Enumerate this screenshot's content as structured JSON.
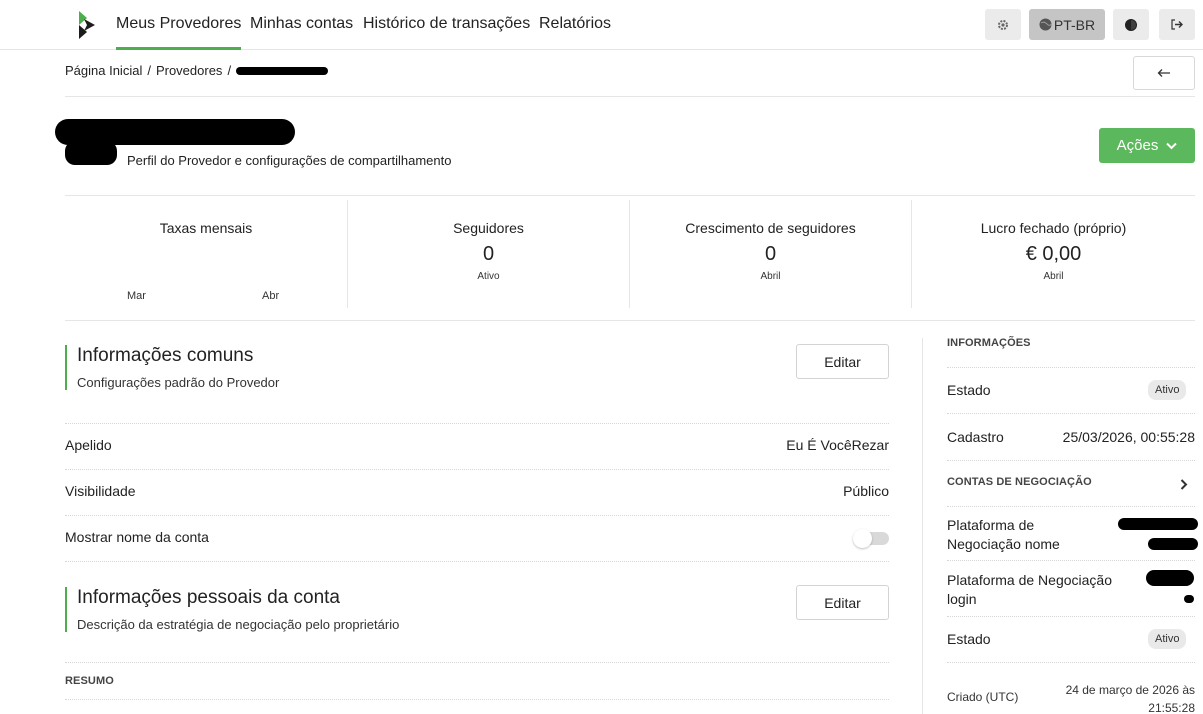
{
  "nav": {
    "items": [
      {
        "label": "Meus Provedores",
        "active": true
      },
      {
        "label": "Minhas contas",
        "active": false
      },
      {
        "label": "Histórico de transações",
        "active": false
      },
      {
        "label": "Relatórios",
        "active": false
      }
    ],
    "language_label": "PT-BR",
    "settings_icon": "gear-icon",
    "theme_icon": "contrast-icon",
    "logout_icon": "logout-icon"
  },
  "breadcrumb": {
    "home": "Página Inicial",
    "separator": "/",
    "providers": "Provedores"
  },
  "back_icon": "arrow-left-icon",
  "profile": {
    "subtitle": "Perfil do Provedor e configurações de compartilhamento",
    "actions_label": "Ações"
  },
  "stats": {
    "monthly_fees": {
      "label": "Taxas mensais",
      "months": [
        "Mar",
        "Abr"
      ]
    },
    "followers": {
      "label": "Seguidores",
      "value": "0",
      "sub": "Ativo"
    },
    "follower_growth": {
      "label": "Crescimento de seguidores",
      "value": "0",
      "sub": "Abril"
    },
    "closed_profit": {
      "label": "Lucro fechado (próprio)",
      "value": "€ 0,00",
      "sub": "Abril"
    }
  },
  "common_info": {
    "title": "Informações comuns",
    "description": "Configurações padrão do Provedor",
    "edit_label": "Editar",
    "rows": [
      {
        "label": "Apelido",
        "value": "Eu É VocêRezar"
      },
      {
        "label": "Visibilidade",
        "value": "Público"
      },
      {
        "label": "Mostrar nome da conta",
        "value": ""
      }
    ],
    "show_account_name": false
  },
  "personal_info": {
    "title": "Informações pessoais da conta",
    "description": "Descrição da estratégia de negociação pelo proprietário",
    "edit_label": "Editar",
    "summary_label": "RESUMO"
  },
  "sidebar": {
    "info_heading": "INFORMAÇÕES",
    "status_label": "Estado",
    "status_value": "Ativo",
    "registered_label": "Cadastro",
    "registered_value": "25/03/2026, 00:55:28",
    "trading_heading": "CONTAS DE NEGOCIAÇÃO",
    "platform_name_label": "Plataforma de Negociação nome",
    "platform_login_label": "Plataforma de Negociação login",
    "account_status_label": "Estado",
    "account_status_value": "Ativo",
    "created_label": "Criado (UTC)",
    "created_value": "24 de março de 2026 às 21:55:28"
  },
  "colors": {
    "accent": "#4cae4c",
    "actions_button": "#5cb85c"
  }
}
